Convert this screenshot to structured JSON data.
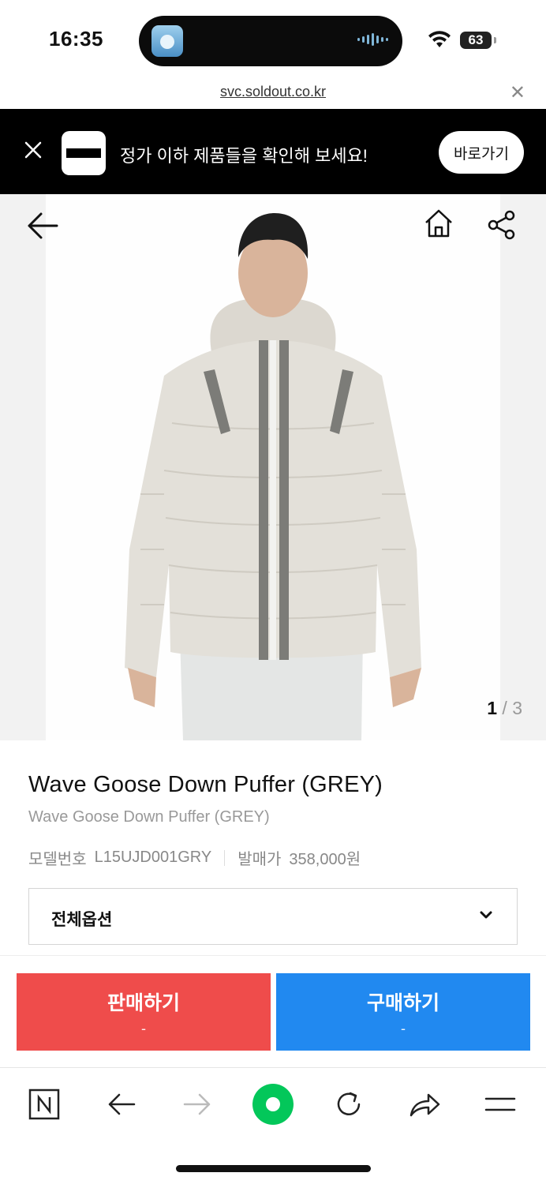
{
  "status_bar": {
    "time": "16:35",
    "battery": "63"
  },
  "url_bar": {
    "url": "svc.soldout.co.kr"
  },
  "promo": {
    "text": "정가 이하 제품들을 확인해 보세요!",
    "button": "바로가기"
  },
  "gallery": {
    "current": "1",
    "separator": "/",
    "total": "3"
  },
  "product": {
    "title": "Wave Goose Down Puffer (GREY)",
    "subtitle": "Wave Goose Down Puffer (GREY)",
    "model_label": "모델번호",
    "model_value": "L15UJD001GRY",
    "price_label": "발매가",
    "price_value": "358,000원"
  },
  "options": {
    "label": "전체옵션"
  },
  "actions": {
    "sell_label": "판매하기",
    "sell_price": "-",
    "buy_label": "구매하기",
    "buy_price": "-"
  },
  "colors": {
    "sell": "#ef4c4b",
    "buy": "#2189f0",
    "banner": "#000000",
    "naver_green": "#03c75a"
  },
  "toolbar": {
    "icons": [
      "naver-n-icon",
      "back-arrow-icon",
      "forward-arrow-icon",
      "naver-green-icon",
      "refresh-icon",
      "share-icon",
      "menu-icon"
    ]
  }
}
